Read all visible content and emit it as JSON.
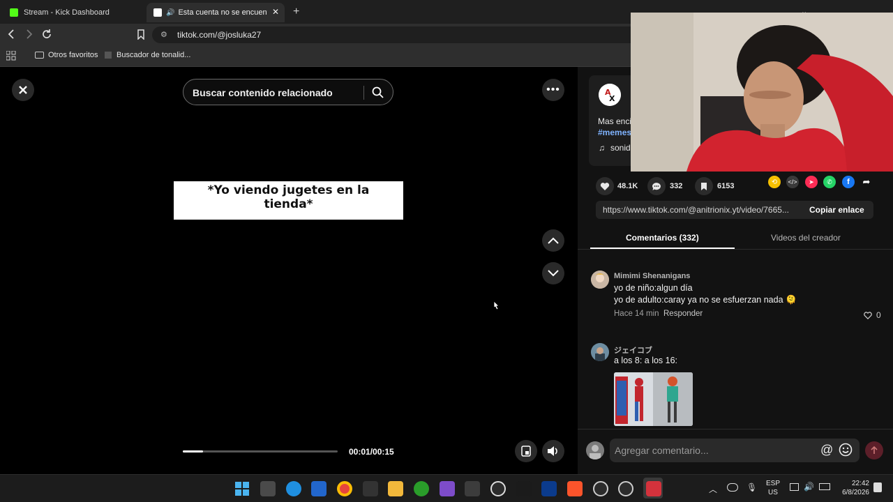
{
  "browser": {
    "tabs": [
      {
        "title": "Stream - Kick Dashboard",
        "active": false
      },
      {
        "title": "Esta cuenta no se encuentra...",
        "active": true
      }
    ],
    "url": "tiktok.com/@josluka27",
    "bookmarks": [
      "Otros favoritos",
      "Buscador de tonalid..."
    ]
  },
  "player": {
    "search_placeholder": "Buscar contenido relacionado",
    "caption_line1": "*Yo viendo jugetes en la",
    "caption_line2": "tienda*",
    "time": "00:01/00:15",
    "progress": 0.13
  },
  "post": {
    "desc_start": "Mas enci",
    "hashtag_start": "#memes",
    "sound_start": "sonid",
    "likes": "48.1K",
    "comments": "332",
    "saves": "6153",
    "link": "https://www.tiktok.com/@anitrionix.yt/video/7665...",
    "copy_label": "Copiar enlace",
    "tab_comments": "Comentarios (332)",
    "tab_videos": "Videos del creador"
  },
  "comments": [
    {
      "user": "Mimimi Shenanigans",
      "line1": "yo de niño:algun día",
      "line2": "yo de adulto:caray ya no se esfuerzan nada 🫠",
      "time": "Hace 14 min",
      "reply": "Responder",
      "likes": "0"
    },
    {
      "user": "ジェイコブ",
      "line1": "a los 8: a los 16:"
    }
  ],
  "composer": {
    "placeholder": "Agregar comentario..."
  },
  "taskbar": {
    "lang": "ESP",
    "region": "US",
    "clock": "22:42",
    "date": "6/8/2026"
  },
  "colors": {
    "accent": "#fe2c55",
    "link": "#7fb3ff"
  }
}
